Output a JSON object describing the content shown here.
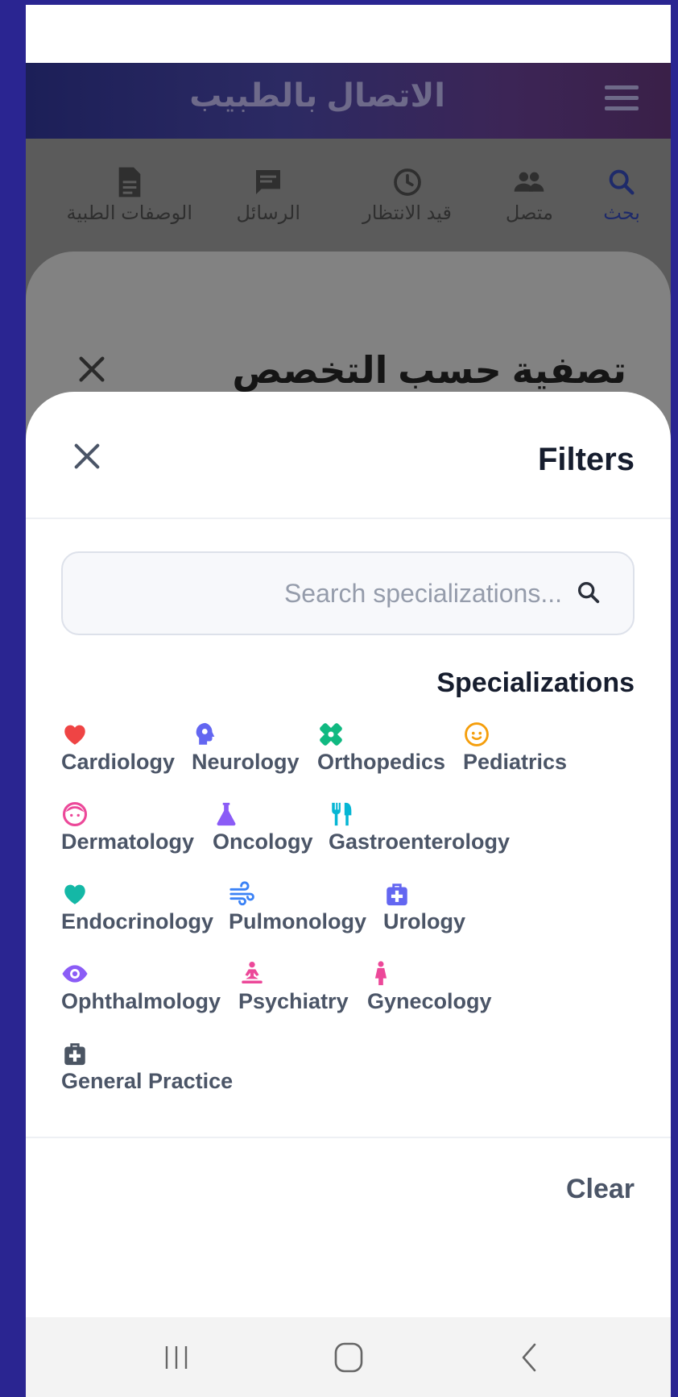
{
  "app_bar": {
    "title": "الاتصال بالطبيب"
  },
  "tabs": [
    {
      "label": "بحث",
      "icon": "search-icon",
      "active": true
    },
    {
      "label": "متصل",
      "icon": "people-icon",
      "active": false
    },
    {
      "label": "قيد الانتظار",
      "icon": "clock-icon",
      "active": false
    },
    {
      "label": "الرسائل",
      "icon": "message-icon",
      "active": false
    },
    {
      "label": "الوصفات الطبية",
      "icon": "document-icon",
      "active": false
    }
  ],
  "background_sheet": {
    "title": "تصفية حسب التخصص"
  },
  "filters": {
    "title": "Filters",
    "search_placeholder": "Search specializations...",
    "section_title": "Specializations",
    "clear_label": "Clear",
    "specializations": [
      {
        "label": "Cardiology",
        "icon": "heart-icon",
        "color": "#ef4444"
      },
      {
        "label": "Neurology",
        "icon": "brain-icon",
        "color": "#6366f1"
      },
      {
        "label": "Orthopedics",
        "icon": "bandage-icon",
        "color": "#10b981"
      },
      {
        "label": "Pediatrics",
        "icon": "baby-face-icon",
        "color": "#f59e0b"
      },
      {
        "label": "Dermatology",
        "icon": "face-icon",
        "color": "#ec4899"
      },
      {
        "label": "Oncology",
        "icon": "flask-icon",
        "color": "#8b5cf6"
      },
      {
        "label": "Gastroenterology",
        "icon": "utensils-icon",
        "color": "#06b6d4"
      },
      {
        "label": "Endocrinology",
        "icon": "heart-icon",
        "color": "#14b8a6"
      },
      {
        "label": "Pulmonology",
        "icon": "wind-icon",
        "color": "#3b82f6"
      },
      {
        "label": "Urology",
        "icon": "medkit-icon",
        "color": "#6366f1"
      },
      {
        "label": "Ophthalmology",
        "icon": "eye-icon",
        "color": "#8b5cf6"
      },
      {
        "label": "Psychiatry",
        "icon": "meditation-icon",
        "color": "#ec4899"
      },
      {
        "label": "Gynecology",
        "icon": "female-icon",
        "color": "#ec4899"
      },
      {
        "label": "General Practice",
        "icon": "medkit-icon",
        "color": "#4b5563"
      }
    ]
  },
  "system_nav": {
    "buttons": [
      "recent-apps-icon",
      "home-icon",
      "back-icon"
    ]
  }
}
